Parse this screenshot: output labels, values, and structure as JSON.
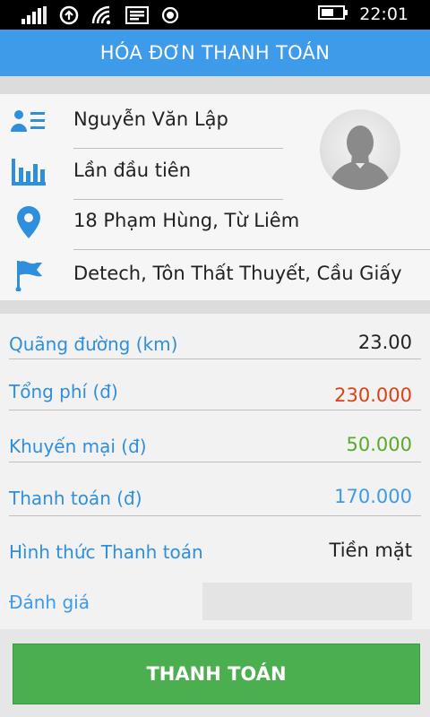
{
  "status_bar": {
    "time": "22:01"
  },
  "header": {
    "title": "HÓA ĐƠN THANH TOÁN"
  },
  "profile": {
    "name": "Nguyễn Văn Lập",
    "trips": "Lần đầu tiên",
    "pickup": "18 Phạm Hùng, Từ Liêm",
    "destination": "Detech, Tôn Thất Thuyết, Cầu Giấy",
    "icons": [
      "contact-card-icon",
      "bar-chart-icon",
      "location-pin-icon",
      "flag-icon"
    ]
  },
  "details": {
    "distance_label": "Quãng đường (km)",
    "distance_value": "23.00",
    "total_label": "Tổng phí (đ)",
    "total_value": "230.000",
    "discount_label": "Khuyến mại (đ)",
    "discount_value": "50.000",
    "payment_label": "Thanh toán (đ)",
    "payment_value": "170.000",
    "method_label": "Hình thức Thanh toán",
    "method_value": "Tiền mặt",
    "rating_label": "Đánh giá"
  },
  "colors": {
    "header": "#3d9be9",
    "label_blue": "#2f8fdc",
    "total_red": "#d84315",
    "discount_green": "#5aaa2a",
    "payment_blue": "#3d9be9",
    "button_green": "#4caf4f"
  },
  "button": {
    "label": "THANH TOÁN"
  }
}
